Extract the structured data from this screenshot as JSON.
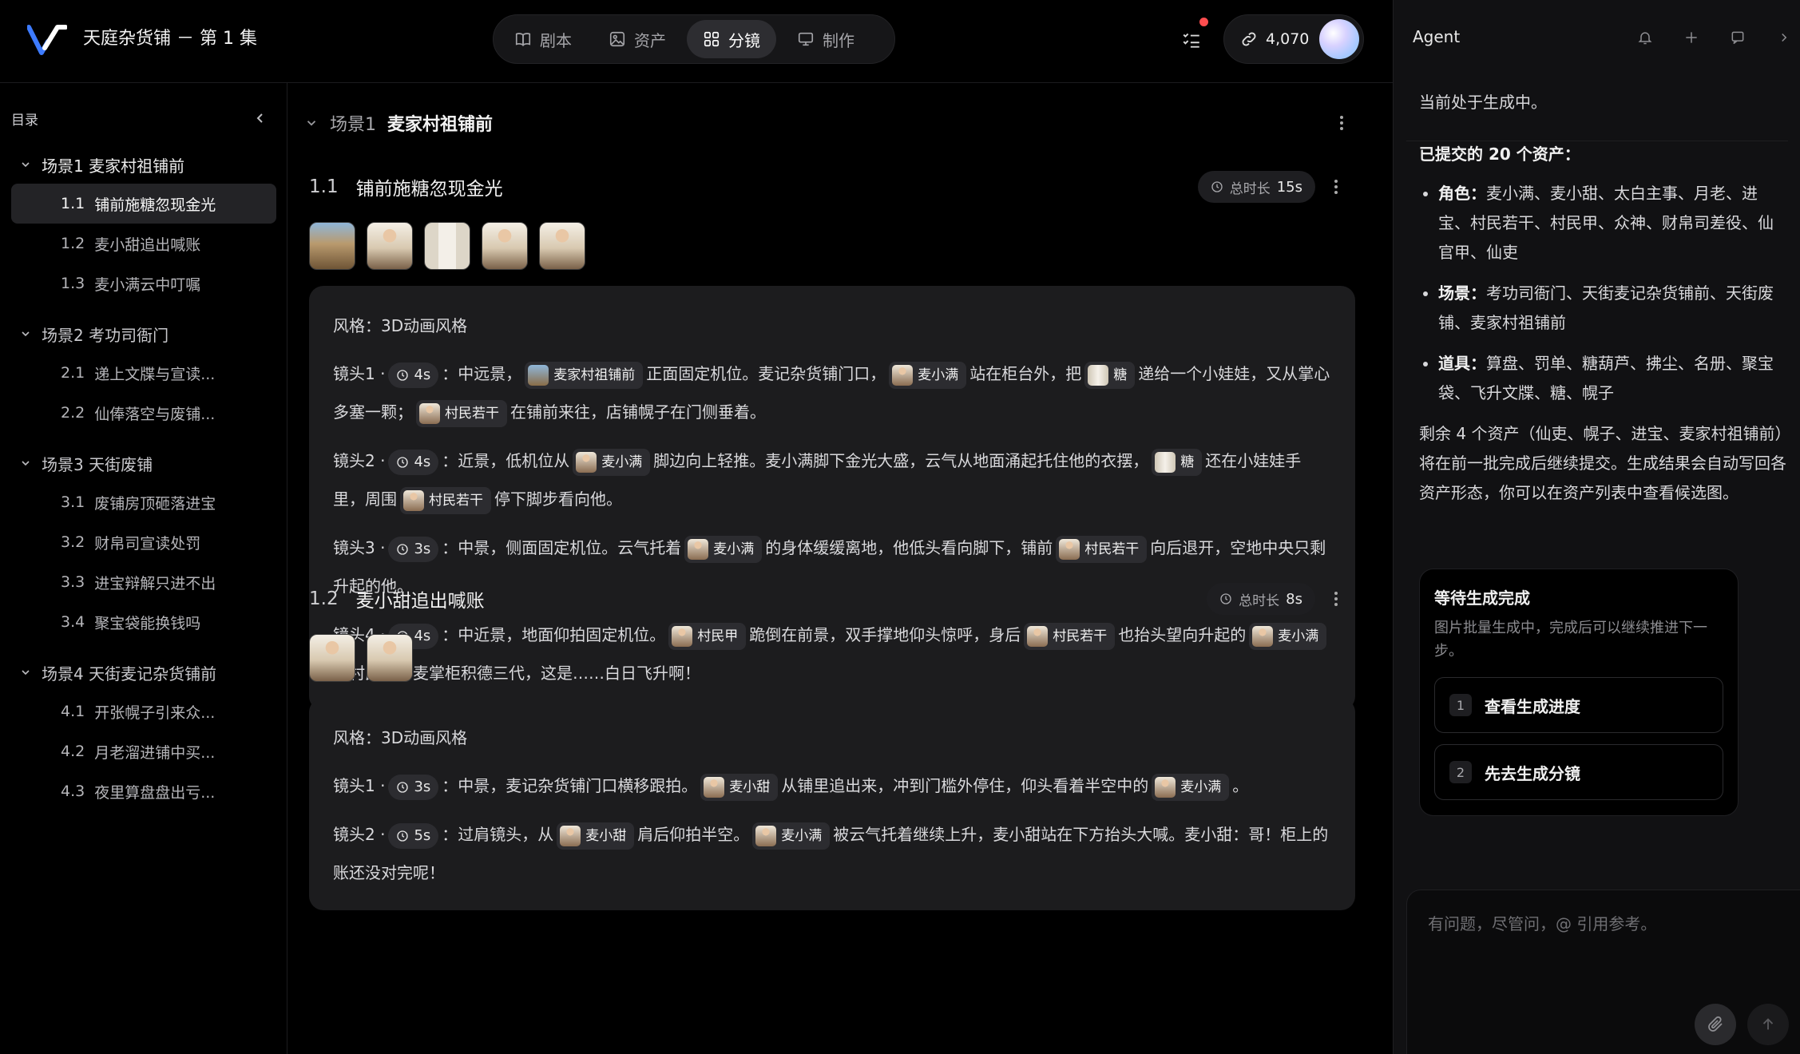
{
  "header": {
    "project_title": "天庭杂货铺 － 第 1 集",
    "tabs": [
      {
        "label": "剧本",
        "icon": "book-icon"
      },
      {
        "label": "资产",
        "icon": "image-icon"
      },
      {
        "label": "分镜",
        "icon": "grid-icon",
        "active": true
      },
      {
        "label": "制作",
        "icon": "monitor-icon"
      }
    ],
    "credits": "4,070"
  },
  "sidebar": {
    "toc_label": "目录",
    "scenes": [
      {
        "label": "场景1",
        "name": "麦家村祖铺前",
        "shots": [
          {
            "num": "1.1",
            "title": "铺前施糖忽现金光",
            "active": true
          },
          {
            "num": "1.2",
            "title": "麦小甜追出喊账"
          },
          {
            "num": "1.3",
            "title": "麦小满云中叮嘱"
          }
        ]
      },
      {
        "label": "场景2",
        "name": "考功司衙门",
        "shots": [
          {
            "num": "2.1",
            "title": "递上文牒与宣读..."
          },
          {
            "num": "2.2",
            "title": "仙俸落空与废铺..."
          }
        ]
      },
      {
        "label": "场景3",
        "name": "天街废铺",
        "shots": [
          {
            "num": "3.1",
            "title": "废铺房顶砸落进宝"
          },
          {
            "num": "3.2",
            "title": "财帛司宣读处罚"
          },
          {
            "num": "3.3",
            "title": "进宝辩解只进不出"
          },
          {
            "num": "3.4",
            "title": "聚宝袋能换钱吗"
          }
        ]
      },
      {
        "label": "场景4",
        "name": "天街麦记杂货铺前",
        "shots": [
          {
            "num": "4.1",
            "title": "开张幌子引来众..."
          },
          {
            "num": "4.2",
            "title": "月老溜进铺中买..."
          },
          {
            "num": "4.3",
            "title": "夜里算盘盘出亏..."
          }
        ]
      }
    ]
  },
  "main": {
    "scene_label": "场景1",
    "scene_name": "麦家村祖铺前",
    "blocks": [
      {
        "num": "1.1",
        "title": "铺前施糖忽现金光",
        "total_label": "总时长",
        "total": "15s",
        "style": "风格：3D动画风格",
        "shots": [
          {
            "prefix": "镜头1 ·",
            "dur": "4s",
            "parts": [
              "：中远景，",
              {
                "tag": "麦家村祖铺前",
                "kind": "scene"
              },
              "正面固定机位。麦记杂货铺门口，",
              {
                "tag": "麦小满",
                "kind": "char"
              },
              "站在柜台外，把",
              {
                "tag": "糖",
                "kind": "prop"
              },
              "递给一个小娃娃，又从掌心多塞一颗；",
              {
                "tag": "村民若干",
                "kind": "char"
              },
              "在铺前来往，店铺幌子在门侧垂着。"
            ]
          },
          {
            "prefix": "镜头2 ·",
            "dur": "4s",
            "parts": [
              "：近景，低机位从",
              {
                "tag": "麦小满",
                "kind": "char"
              },
              "脚边向上轻推。麦小满脚下金光大盛，云气从地面涌起托住他的衣摆，",
              {
                "tag": "糖",
                "kind": "prop"
              },
              "还在小娃娃手里，周围",
              {
                "tag": "村民若干",
                "kind": "char"
              },
              "停下脚步看向他。"
            ]
          },
          {
            "prefix": "镜头3 ·",
            "dur": "3s",
            "parts": [
              "：中景，侧面固定机位。云气托着",
              {
                "tag": "麦小满",
                "kind": "char"
              },
              "的身体缓缓离地，他低头看向脚下，铺前",
              {
                "tag": "村民若干",
                "kind": "char"
              },
              "向后退开，空地中央只剩升起的他。"
            ]
          },
          {
            "prefix": "镜头4 ·",
            "dur": "4s",
            "parts": [
              "：中近景，地面仰拍固定机位。",
              {
                "tag": "村民甲",
                "kind": "char"
              },
              "跪倒在前景，双手撑地仰头惊呼，身后",
              {
                "tag": "村民若干",
                "kind": "char"
              },
              "也抬头望向升起的",
              {
                "tag": "麦小满",
                "kind": "char"
              },
              "。村民甲：麦掌柜积德三代，这是……白日飞升啊！"
            ]
          }
        ],
        "thumbs": [
          "scene",
          "char",
          "prop",
          "char",
          "char"
        ]
      },
      {
        "num": "1.2",
        "title": "麦小甜追出喊账",
        "total_label": "总时长",
        "total": "8s",
        "style": "风格：3D动画风格",
        "shots": [
          {
            "prefix": "镜头1 ·",
            "dur": "3s",
            "parts": [
              "：中景，麦记杂货铺门口横移跟拍。",
              {
                "tag": "麦小甜",
                "kind": "char"
              },
              "从铺里追出来，冲到门槛外停住，仰头看着半空中的",
              {
                "tag": "麦小满",
                "kind": "char"
              },
              "。"
            ]
          },
          {
            "prefix": "镜头2 ·",
            "dur": "5s",
            "parts": [
              "：过肩镜头，从",
              {
                "tag": "麦小甜",
                "kind": "char"
              },
              "肩后仰拍半空。",
              {
                "tag": "麦小满",
                "kind": "char"
              },
              "被云气托着继续上升，麦小甜站在下方抬头大喊。麦小甜：哥！柜上的账还没对完呢！"
            ]
          }
        ],
        "thumbs": [
          "char",
          "char"
        ]
      }
    ]
  },
  "agent": {
    "title": "Agent",
    "status": "当前处于生成中。",
    "submitted_head": "已提交的 20 个资产：",
    "assets": [
      {
        "label": "角色：",
        "text": "麦小满、麦小甜、太白主事、月老、进宝、村民若干、村民甲、众神、财帛司差役、仙官甲、仙吏"
      },
      {
        "label": "场景：",
        "text": "考功司衙门、天街麦记杂货铺前、天街废铺、麦家村祖铺前"
      },
      {
        "label": "道具：",
        "text": "算盘、罚单、糖葫芦、拂尘、名册、聚宝袋、飞升文牒、糖、幌子"
      }
    ],
    "remaining": "剩余 4 个资产（仙吏、幌子、进宝、麦家村祖铺前）将在前一批完成后继续提交。生成结果会自动写回各资产形态，你可以在资产列表中查看候选图。",
    "wait_card": {
      "title": "等待生成完成",
      "desc": "图片批量生成中，完成后可以继续推进下一步。",
      "options": [
        {
          "idx": "1",
          "label": "查看生成进度"
        },
        {
          "idx": "2",
          "label": "先去生成分镜"
        }
      ]
    },
    "input_placeholder": "有问题，尽管问，@ 引用参考。"
  },
  "colors": {
    "background": "#000000",
    "panel": "#111113",
    "card": "#1c1c1e",
    "notification_dot": "#ff4d4f",
    "logo_blue": "#3d7bff"
  }
}
